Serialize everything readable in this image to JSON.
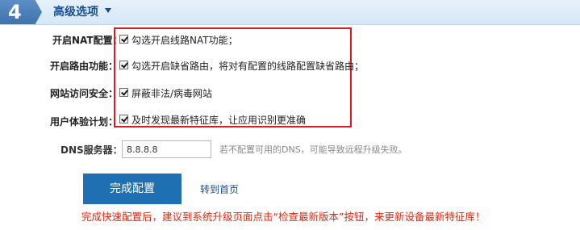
{
  "step": {
    "number": "4",
    "title": "高级选项"
  },
  "options": [
    {
      "label": "开启NAT配置：",
      "checked": true,
      "text": "勾选开启线路NAT功能；"
    },
    {
      "label": "开启路由功能：",
      "checked": true,
      "text": "勾选开启缺省路由，将对有配置的线路配置缺省路由；"
    },
    {
      "label": "网站访问安全：",
      "checked": true,
      "text": "屏蔽非法/病毒网站"
    },
    {
      "label": "用户体验计划：",
      "checked": true,
      "text": "及时发现最新特征库，让应用识别更准确"
    }
  ],
  "dns": {
    "label": "DNS服务器：",
    "value": "8.8.8.8",
    "hint": "若不配置可用的DNS，可能导致远程升级失败。"
  },
  "actions": {
    "finish_label": "完成配置",
    "home_link": "转到首页"
  },
  "notice": "完成快速配置后，建议到系统升级页面点击“检查最新版本”按钮，来更新设备最新特征库！",
  "colors": {
    "header_bg": "#dce9f7",
    "badge_bg": "#4a7fbb",
    "title_color": "#1a4d8f",
    "highlight_border": "#e01820",
    "primary_button": "#1f6fb3",
    "notice_color": "#e2260f"
  }
}
